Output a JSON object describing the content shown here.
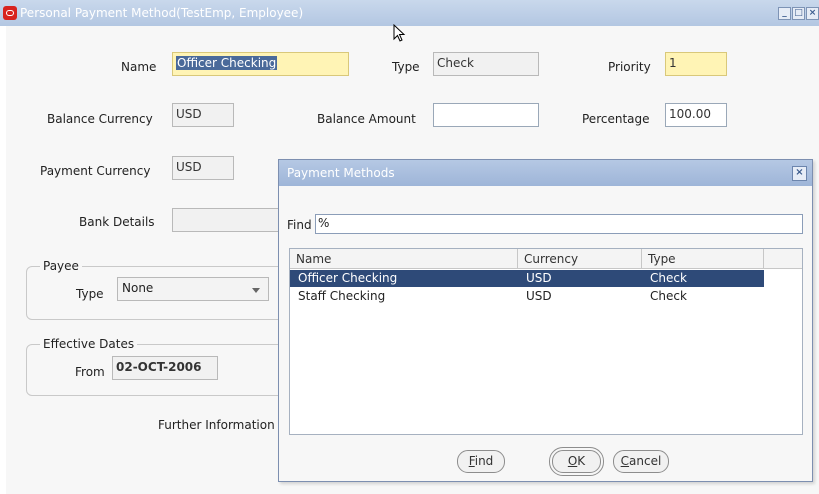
{
  "window": {
    "title": "Personal Payment Method(TestEmp, Employee)",
    "min_glyph": "_",
    "max_glyph": "□",
    "close_glyph": "×"
  },
  "form": {
    "name_label": "Name",
    "name_value": "Officer Checking",
    "type_label": "Type",
    "type_value": "Check",
    "priority_label": "Priority",
    "priority_value": "1",
    "balance_currency_label": "Balance Currency",
    "balance_currency_value": "USD",
    "balance_amount_label": "Balance Amount",
    "balance_amount_value": "",
    "percentage_label": "Percentage",
    "percentage_value": "100.00",
    "payment_currency_label": "Payment Currency",
    "payment_currency_value": "USD",
    "bank_details_label": "Bank Details",
    "bank_details_value": "",
    "payee_group_title": "Payee",
    "payee_type_label": "Type",
    "payee_type_value": "None",
    "effective_dates_title": "Effective Dates",
    "from_label": "From",
    "from_value": "02-OCT-2006",
    "further_info_label": "Further Information"
  },
  "dialog": {
    "title": "Payment Methods",
    "find_label": "Find",
    "find_value": "%",
    "columns": [
      "Name",
      "Currency",
      "Type"
    ],
    "rows": [
      {
        "name": "Officer Checking",
        "currency": "USD",
        "type": "Check",
        "selected": true
      },
      {
        "name": "Staff Checking",
        "currency": "USD",
        "type": "Check",
        "selected": false
      }
    ],
    "buttons": {
      "find_underlined": "F",
      "find_rest": "ind",
      "ok_underlined": "O",
      "ok_rest": "K",
      "cancel_underlined": "C",
      "cancel_rest": "ancel"
    }
  },
  "colors": {
    "titlebar": "#b3c7e2",
    "required_field": "#fff4b5",
    "selection": "#2e4a78"
  }
}
